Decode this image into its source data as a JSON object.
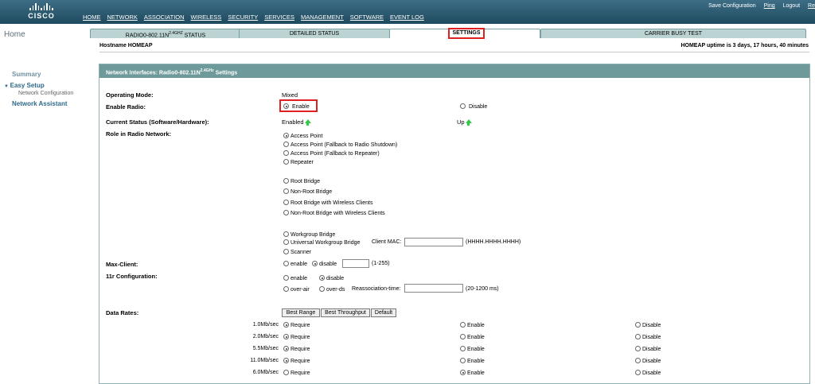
{
  "brand": "CISCO",
  "nav": [
    "HOME",
    "NETWORK",
    "ASSOCIATION",
    "WIRELESS",
    "SECURITY",
    "SERVICES",
    "MANAGEMENT",
    "SOFTWARE",
    "EVENT LOG"
  ],
  "top_links": {
    "save": "Save Configuration",
    "ping": "Ping",
    "logout": "Logout",
    "refresh": "Re"
  },
  "sidebar": {
    "home": "Home",
    "summary": "Summary",
    "easy_setup": "Easy Setup",
    "network_config": "Network Configuration",
    "network_assistant": "Network Assistant"
  },
  "tabs": {
    "status_pre": "RADIO0-802.11N",
    "status_sup": "2.4GHZ",
    "status_post": " STATUS",
    "detailed": "DETAILED STATUS",
    "settings": "SETTINGS",
    "carrier": "CARRIER BUSY TEST"
  },
  "hostname": "Hostname  HOMEAP",
  "uptime": "HOMEAP uptime is 3 days, 17 hours, 40 minutes",
  "panel_title": {
    "pre": "Network Interfaces: Radio0-802.11N",
    "sup": "2.4GHz",
    "post": " Settings"
  },
  "operating_mode": {
    "label": "Operating Mode:",
    "value": "Mixed"
  },
  "enable_radio": {
    "label": "Enable Radio:",
    "enable": "Enable",
    "disable": "Disable"
  },
  "current_status": {
    "label": "Current Status (Software/Hardware):",
    "software": "Enabled",
    "hardware": "Up"
  },
  "role": {
    "label": "Role in Radio Network:",
    "group1": [
      "Access Point",
      "Access Point (Fallback to Radio Shutdown)",
      "Access Point (Fallback to Repeater)",
      "Repeater"
    ],
    "group2": [
      "Root Bridge",
      "Non-Root Bridge",
      "Root Bridge with Wireless Clients",
      "Non-Root Bridge with Wireless Clients"
    ],
    "group3": [
      "Workgroup Bridge",
      "Universal Workgroup Bridge",
      "Scanner"
    ],
    "client_mac_label": "Client MAC:",
    "client_mac_hint": "(HHHH.HHHH.HHHH)"
  },
  "max_client": {
    "label": "Max-Client:",
    "enable": "enable",
    "disable": "disable",
    "hint": "(1-255)"
  },
  "r11": {
    "label": "11r Configuration:",
    "enable": "enable",
    "disable": "disable",
    "over_air": "over-air",
    "over_ds": "over-ds",
    "reassoc_label": "Reassociation-time:",
    "reassoc_hint": "(20-1200 ms)"
  },
  "data_rates": {
    "label": "Data Rates:",
    "buttons": [
      "Best Range",
      "Best Throughput",
      "Default"
    ],
    "col_require": "Require",
    "col_enable": "Enable",
    "col_disable": "Disable",
    "rows": [
      {
        "rate": "1.0Mb/sec",
        "sel": "require"
      },
      {
        "rate": "2.0Mb/sec",
        "sel": "require"
      },
      {
        "rate": "5.5Mb/sec",
        "sel": "require"
      },
      {
        "rate": "11.0Mb/sec",
        "sel": "require"
      },
      {
        "rate": "6.0Mb/sec",
        "sel": "enable"
      }
    ]
  }
}
